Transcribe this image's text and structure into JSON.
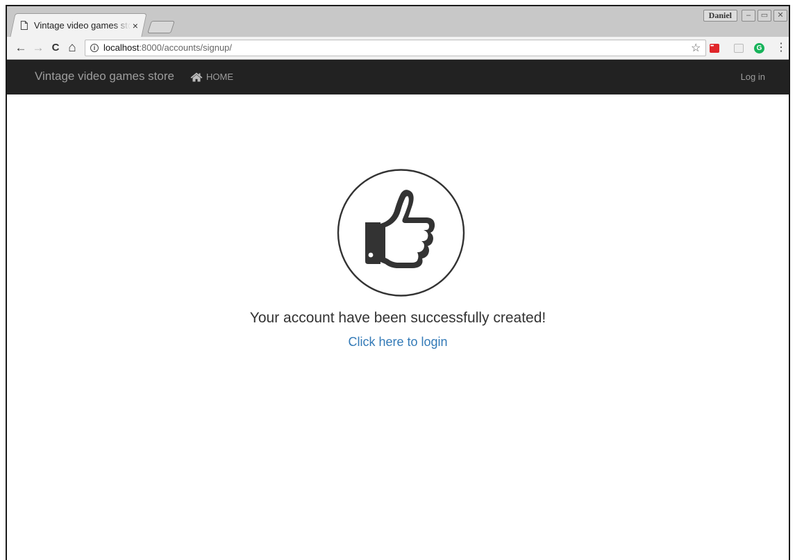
{
  "browser": {
    "tab_title": "Vintage video games store",
    "tab_close": "×",
    "profile_name": "Daniel",
    "window_controls": {
      "minimize": "–",
      "maximize": "▭",
      "close": "✕"
    },
    "nav": {
      "back": "←",
      "forward": "→",
      "reload": "C",
      "home": "⌂"
    },
    "url_host": "localhost",
    "url_path": ":8000/accounts/signup/",
    "info_icon": "i",
    "bookmark_icon": "☆",
    "menu_icon": "⋮",
    "extension_g": "G"
  },
  "site_nav": {
    "brand": "Vintage video games store",
    "home_label": "HOME",
    "login_label": "Log in"
  },
  "main": {
    "icon": "thumbs-up-icon",
    "message": "Your account have been successfully created!",
    "login_link": "Click here to login"
  },
  "colors": {
    "navbar_bg": "#222222",
    "navbar_text": "#9d9d9d",
    "link": "#337ab7",
    "text": "#333333"
  }
}
